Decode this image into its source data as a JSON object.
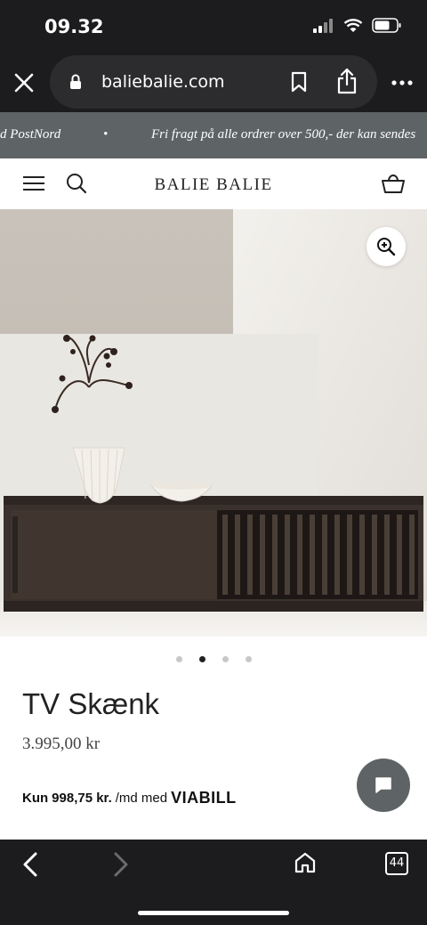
{
  "status": {
    "time": "09.32"
  },
  "browser": {
    "url": "baliebalie.com",
    "tabs_count": "44"
  },
  "ticker": {
    "left_text": "d PostNord",
    "separator": "•",
    "right_text": "Fri fragt på alle ordrer over 500,- der kan sendes"
  },
  "header": {
    "brand": "BALIE BALIE"
  },
  "product": {
    "title": "TV Skænk",
    "price": "3.995,00 kr",
    "viabill_prefix": "Kun",
    "viabill_amount": "998,75 kr.",
    "viabill_suffix": "/md med",
    "viabill_logo": "VIABILL"
  },
  "carousel": {
    "slides": 4,
    "active_index": 1
  },
  "icons": {
    "close": "close-icon",
    "lock": "lock-icon",
    "bookmark": "bookmark-icon",
    "share": "share-icon",
    "more": "more-icon",
    "menu": "hamburger-icon",
    "search": "search-icon",
    "cart": "basket-icon",
    "zoom": "zoom-in-icon",
    "chat": "chat-icon",
    "back": "back-icon",
    "forward": "forward-icon",
    "home": "home-icon"
  }
}
